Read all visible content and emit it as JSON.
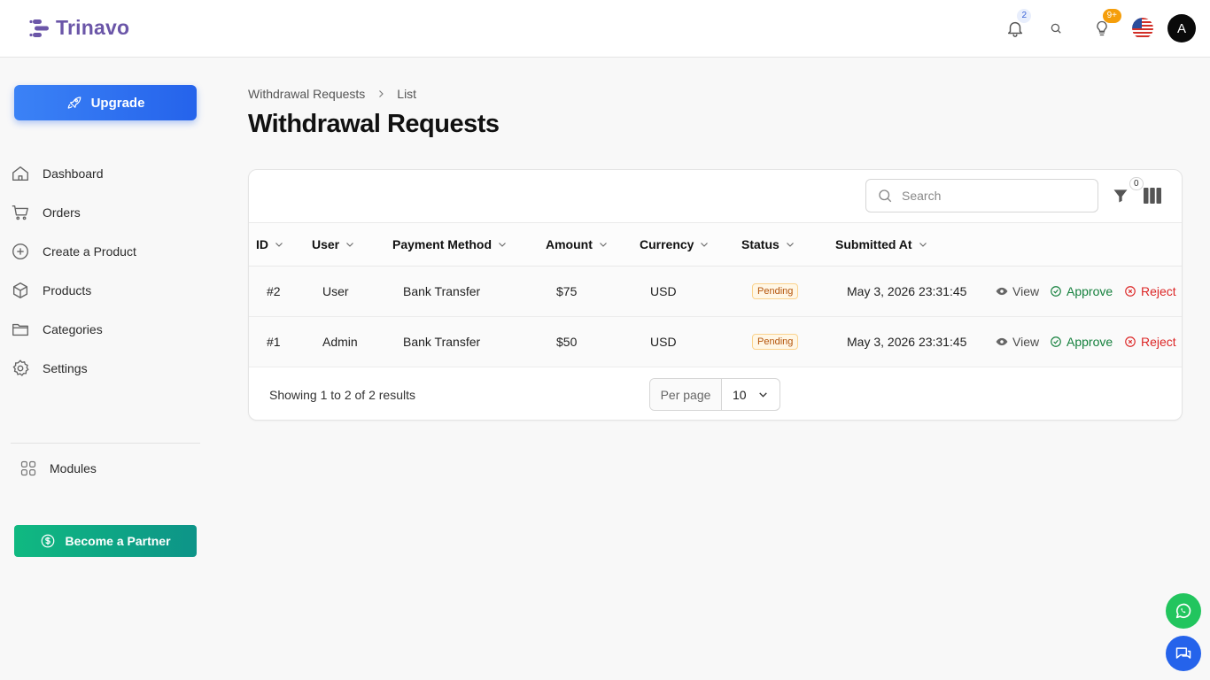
{
  "app": {
    "brand": "Trinavo"
  },
  "topbar": {
    "notifications_count": "2",
    "tips_count": "9+",
    "avatar_initial": "A"
  },
  "sidebar": {
    "upgrade_label": "Upgrade",
    "items": [
      {
        "label": "Dashboard",
        "icon": "home-icon"
      },
      {
        "label": "Orders",
        "icon": "cart-icon"
      },
      {
        "label": "Create a Product",
        "icon": "plus-circle-icon"
      },
      {
        "label": "Products",
        "icon": "box-icon"
      },
      {
        "label": "Categories",
        "icon": "folder-icon"
      },
      {
        "label": "Settings",
        "icon": "gear-icon"
      }
    ],
    "modules_label": "Modules",
    "partner_label": "Become a Partner"
  },
  "breadcrumb": {
    "parent": "Withdrawal Requests",
    "current": "List"
  },
  "page": {
    "title": "Withdrawal Requests"
  },
  "table": {
    "search_placeholder": "Search",
    "filter_count": "0",
    "columns": [
      "ID",
      "User",
      "Payment Method",
      "Amount",
      "Currency",
      "Status",
      "Submitted At"
    ],
    "rows": [
      {
        "id": "#2",
        "user": "User",
        "method": "Bank Transfer",
        "amount": "$75",
        "currency": "USD",
        "status": "Pending",
        "submitted": "May 3, 2026 23:31:45"
      },
      {
        "id": "#1",
        "user": "Admin",
        "method": "Bank Transfer",
        "amount": "$50",
        "currency": "USD",
        "status": "Pending",
        "submitted": "May 3, 2026 23:31:45"
      }
    ],
    "actions": {
      "view": "View",
      "approve": "Approve",
      "reject": "Reject"
    },
    "showing": "Showing 1 to 2 of 2 results",
    "per_page_label": "Per page",
    "per_page_value": "10"
  },
  "colors": {
    "brand": "#6b56a8",
    "primary": "#2563eb",
    "success": "#15803d",
    "danger": "#dc2626",
    "warning": "#b45309"
  }
}
